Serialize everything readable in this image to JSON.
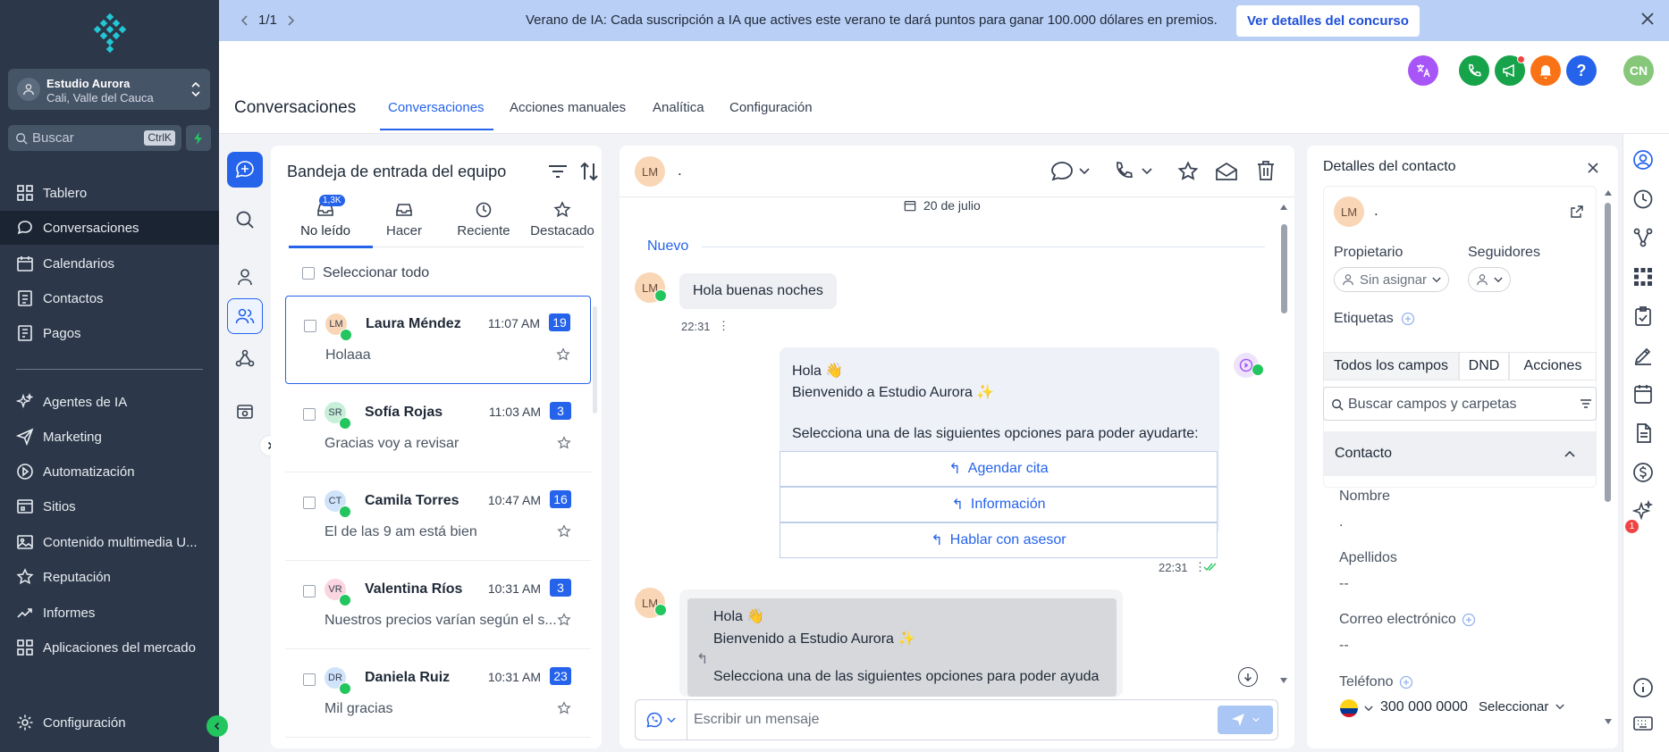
{
  "sidebar": {
    "account": {
      "name": "Estudio Aurora",
      "location": "Cali, Valle del Cauca"
    },
    "search": {
      "placeholder": "Buscar",
      "shortcut": "CtrlK"
    },
    "items": [
      {
        "label": "Tablero",
        "icon": "dashboard-icon"
      },
      {
        "label": "Conversaciones",
        "icon": "chat-icon",
        "active": true
      },
      {
        "label": "Calendarios",
        "icon": "calendar-icon"
      },
      {
        "label": "Contactos",
        "icon": "contacts-icon"
      },
      {
        "label": "Pagos",
        "icon": "payments-icon"
      }
    ],
    "items2": [
      {
        "label": "Agentes de IA",
        "icon": "sparkle-icon"
      },
      {
        "label": "Marketing",
        "icon": "send-icon"
      },
      {
        "label": "Automatización",
        "icon": "automation-icon"
      },
      {
        "label": "Sitios",
        "icon": "sites-icon"
      },
      {
        "label": "Contenido multimedia U...",
        "icon": "media-icon"
      },
      {
        "label": "Reputación",
        "icon": "star-icon"
      },
      {
        "label": "Informes",
        "icon": "reports-icon"
      },
      {
        "label": "Aplicaciones del mercado",
        "icon": "apps-icon"
      }
    ],
    "settings_label": "Configuración"
  },
  "banner": {
    "pager": "1/1",
    "message": "Verano de IA: Cada suscripción a IA que actives este verano te dará puntos para ganar 100.000 dólares en premios.",
    "cta": "Ver detalles del concurso"
  },
  "header": {
    "title": "Conversaciones",
    "tabs": [
      "Conversaciones",
      "Acciones manuales",
      "Analítica",
      "Configuración"
    ],
    "avatar_initials": "CN",
    "colors": {
      "translate": "#a855f7",
      "phone": "#16a34a",
      "announce": "#16a34a",
      "bell": "#f97316",
      "help": "#2563eb",
      "avatar": "#86c77a"
    }
  },
  "inbox": {
    "title": "Bandeja de entrada del equipo",
    "tabs": [
      {
        "label": "No leído",
        "badge": "1,3K"
      },
      {
        "label": "Hacer"
      },
      {
        "label": "Reciente"
      },
      {
        "label": "Destacado"
      }
    ],
    "select_all": "Seleccionar todo",
    "conversations": [
      {
        "initials": "LM",
        "name": "Laura Méndez",
        "time": "11:07 AM",
        "count": "19",
        "preview": "Holaaa",
        "avatar_color": "#f9d6b6"
      },
      {
        "initials": "SR",
        "name": "Sofía Rojas",
        "time": "11:03 AM",
        "count": "3",
        "preview": "Gracias voy a revisar",
        "avatar_color": "#c7efd9"
      },
      {
        "initials": "CT",
        "name": "Camila Torres",
        "time": "10:47 AM",
        "count": "16",
        "preview": "El de las 9 am está bien",
        "avatar_color": "#cfe3fb"
      },
      {
        "initials": "VR",
        "name": "Valentina Ríos",
        "time": "10:31 AM",
        "count": "3",
        "preview": "Nuestros precios varían según el s...",
        "avatar_color": "#fbd5e0"
      },
      {
        "initials": "DR",
        "name": "Daniela Ruiz",
        "time": "10:31 AM",
        "count": "23",
        "preview": "Mil gracias",
        "avatar_color": "#cfe3fb"
      }
    ]
  },
  "chat": {
    "contact_initials": "LM",
    "contact_name": ".",
    "date_label": "20 de julio",
    "new_label": "Nuevo",
    "messages": {
      "m1": {
        "text": "Hola buenas noches",
        "time": "22:31"
      },
      "m2": {
        "line1": "Hola 👋",
        "line2": "Bienvenido a Estudio Aurora ✨",
        "line3": "Selecciona una de las siguientes opciones para poder ayudarte:",
        "time": "22:31",
        "buttons": [
          "Agendar cita",
          "Información",
          "Hablar con asesor"
        ]
      },
      "m3": {
        "line1": "Hola 👋",
        "line2": "Bienvenido a Estudio Aurora ✨",
        "line3": "Selecciona una de las siguientes opciones para poder ayuda"
      }
    },
    "composer_placeholder": "Escribir un mensaje"
  },
  "details": {
    "title": "Detalles del contacto",
    "initials": "LM",
    "name": ".",
    "owner_label": "Propietario",
    "owner_value": "Sin asignar",
    "followers_label": "Seguidores",
    "tags_label": "Etiquetas",
    "segments": [
      "Todos los campos",
      "DND",
      "Acciones"
    ],
    "search_placeholder": "Buscar campos y carpetas",
    "section": "Contacto",
    "fields": {
      "name_label": "Nombre",
      "name_value": ".",
      "lastname_label": "Apellidos",
      "lastname_value": "--",
      "email_label": "Correo electrónico",
      "email_value": "--",
      "phone_label": "Teléfono",
      "phone_value": "300 000 0000",
      "phone_type": "Seleccionar"
    }
  },
  "rightbar": {
    "notification_count": "1"
  }
}
